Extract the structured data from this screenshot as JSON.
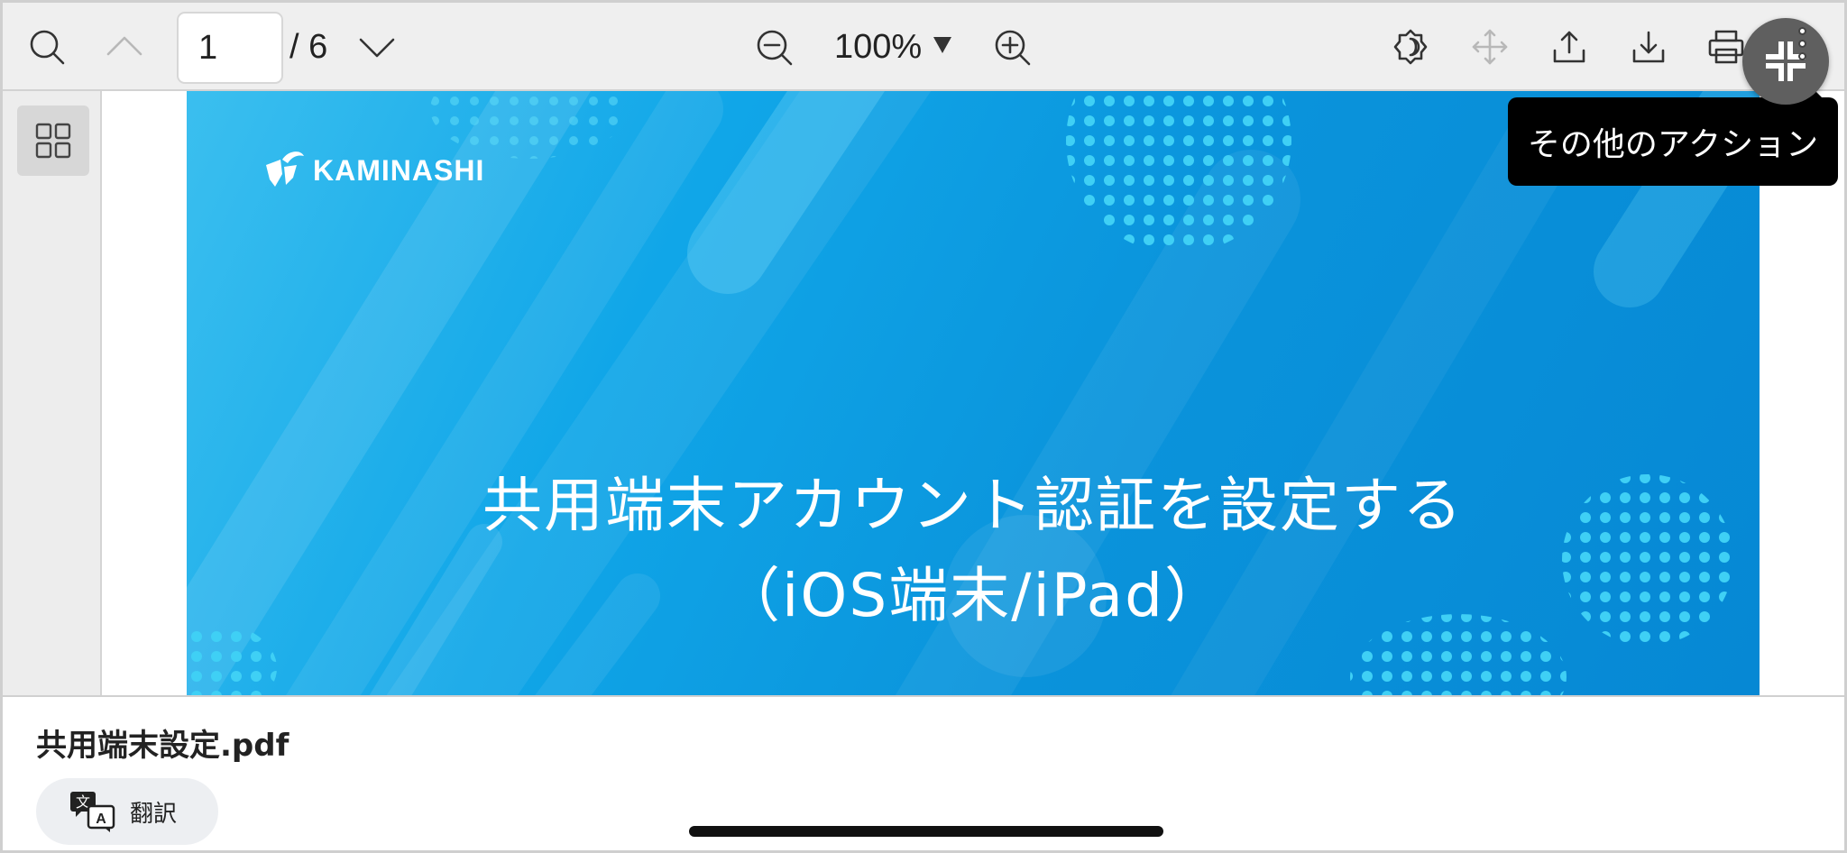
{
  "toolbar": {
    "current_page": "1",
    "total_pages": "/ 6",
    "zoom": "100%",
    "icons": [
      "search-icon",
      "chevron-up-icon",
      "chevron-down-icon",
      "zoom-out-icon",
      "zoom-in-icon",
      "brightness-icon",
      "move-icon",
      "upload-icon",
      "download-icon",
      "print-icon",
      "collapse-icon",
      "more-vertical-icon"
    ]
  },
  "tooltip": {
    "text": "その他のアクション"
  },
  "document": {
    "logo_text": "KAMINASHI",
    "title_line1": "共用端末アカウント認証を設定する",
    "title_line2": "（iOS端末/iPad）"
  },
  "footer": {
    "filename": "共用端末設定.pdf",
    "translate_label": "翻訳"
  },
  "colors": {
    "toolbar_bg": "#efefef",
    "slide_blue": "#0a93db",
    "fab_bg": "#5f5f5f",
    "tooltip_bg": "#000000"
  }
}
